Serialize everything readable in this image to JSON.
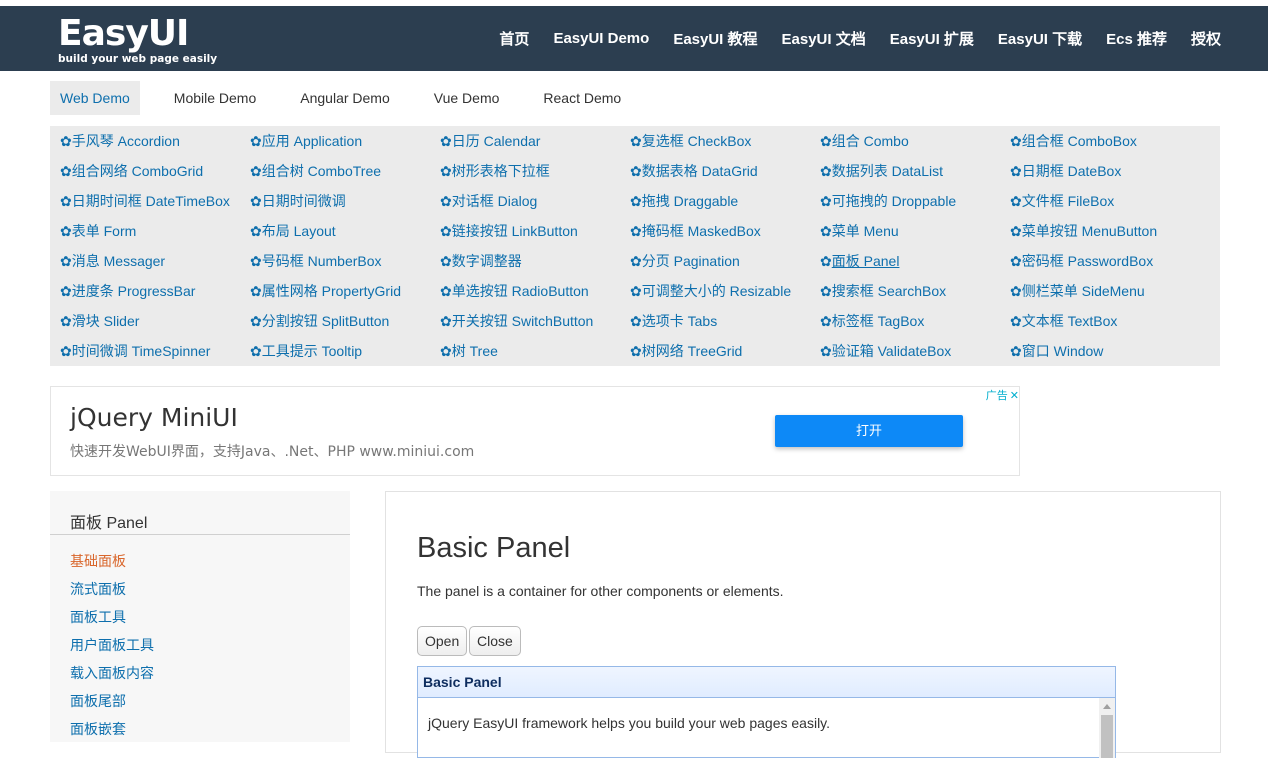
{
  "logo": {
    "name": "EasyUI",
    "tagline": "build your web page easily"
  },
  "main_nav": [
    "首页",
    "EasyUI Demo",
    "EasyUI 教程",
    "EasyUI 文档",
    "EasyUI 扩展",
    "EasyUI 下载",
    "Ecs 推荐",
    "授权"
  ],
  "sub_nav": {
    "items": [
      "Web Demo",
      "Mobile Demo",
      "Angular Demo",
      "Vue Demo",
      "React Demo"
    ],
    "active": "Web Demo"
  },
  "component_icon": "gear-icon",
  "components": [
    [
      "手风琴 Accordion",
      "应用 Application",
      "日历 Calendar",
      "复选框 CheckBox",
      "组合 Combo",
      "组合框 ComboBox"
    ],
    [
      "组合网络 ComboGrid",
      "组合树 ComboTree",
      "树形表格下拉框",
      "数据表格 DataGrid",
      "数据列表 DataList",
      "日期框 DateBox"
    ],
    [
      "日期时间框 DateTimeBox",
      "日期时间微调",
      "对话框 Dialog",
      "拖拽 Draggable",
      "可拖拽的 Droppable",
      "文件框 FileBox"
    ],
    [
      "表单 Form",
      "布局 Layout",
      "链接按钮 LinkButton",
      "掩码框 MaskedBox",
      "菜单 Menu",
      "菜单按钮 MenuButton"
    ],
    [
      "消息 Messager",
      "号码框 NumberBox",
      "数字调整器",
      "分页 Pagination",
      "面板 Panel",
      "密码框 PasswordBox"
    ],
    [
      "进度条 ProgressBar",
      "属性网格 PropertyGrid",
      "单选按钮 RadioButton",
      "可调整大小的 Resizable",
      "搜索框 SearchBox",
      "侧栏菜单 SideMenu"
    ],
    [
      "滑块 Slider",
      "分割按钮 SplitButton",
      "开关按钮 SwitchButton",
      "选项卡 Tabs",
      "标签框 TagBox",
      "文本框 TextBox"
    ],
    [
      "时间微调 TimeSpinner",
      "工具提示 Tooltip",
      "树 Tree",
      "树网络 TreeGrid",
      "验证箱 ValidateBox",
      "窗口 Window"
    ]
  ],
  "current_component": "面板 Panel",
  "ad": {
    "title": "jQuery MiniUI",
    "description": "快速开发WebUI界面，支持Java、.Net、PHP www.miniui.com",
    "button": "打开",
    "tag": "广告",
    "close_symbol": "✕"
  },
  "sidebar": {
    "title": "面板 Panel",
    "items": [
      "基础面板",
      "流式面板",
      "面板工具",
      "用户面板工具",
      "载入面板内容",
      "面板尾部",
      "面板嵌套"
    ],
    "active": "基础面板"
  },
  "content": {
    "title": "Basic Panel",
    "description": "The panel is a container for other components or elements.",
    "open_button": "Open",
    "close_button": "Close",
    "panel_title": "Basic Panel",
    "panel_body": "jQuery EasyUI framework helps you build your web pages easily."
  }
}
